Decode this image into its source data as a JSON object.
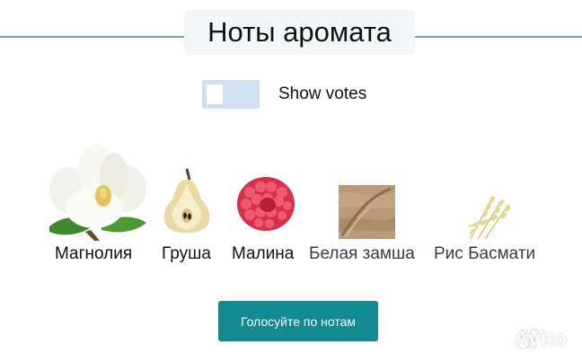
{
  "header": {
    "title": "Ноты аромата"
  },
  "votes_toggle": {
    "label": "Show votes",
    "state": "off"
  },
  "notes": [
    {
      "name": "Магнолия",
      "icon": "magnolia-flower-image"
    },
    {
      "name": "Груша",
      "icon": "pear-image"
    },
    {
      "name": "Малина",
      "icon": "raspberry-image"
    },
    {
      "name": "Белая замша",
      "icon": "white-suede-image"
    },
    {
      "name": "Рис Басмати",
      "icon": "basmati-rice-image"
    }
  ],
  "vote_button": {
    "label": "Голосуйте по нотам"
  },
  "watermark": {
    "text": "Avito",
    "icon": "avito-logo"
  },
  "colors": {
    "accent": "#118a92",
    "rule": "#6fa6b4",
    "toggle_track": "#cfe0ee"
  }
}
